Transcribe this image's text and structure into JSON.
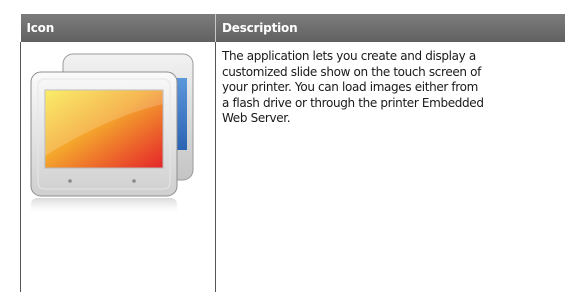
{
  "table": {
    "headers": {
      "icon": "Icon",
      "description": "Description"
    },
    "rows": [
      {
        "icon": "slideshow-screens-icon",
        "description": "The application lets you create and display a\ncustomized slide show on the touch screen of\nyour printer. You can load images either from\na flash drive or through the printer Embedded\nWeb Server."
      }
    ]
  },
  "colors": {
    "header_bg": "#6e6e6e",
    "header_text": "#ffffff",
    "border": "#555555",
    "screen_gradient_start": "#f7e33a",
    "screen_gradient_mid": "#f39a2a",
    "screen_gradient_end": "#e8262a",
    "back_screen": "#3a78c8"
  }
}
